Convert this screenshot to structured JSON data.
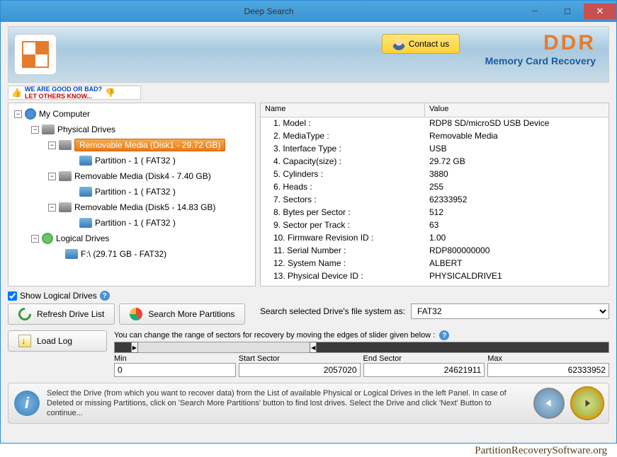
{
  "window": {
    "title": "Deep Search"
  },
  "banner": {
    "contact": "Contact us",
    "brand": "DDR",
    "brand_sub": "Memory Card Recovery"
  },
  "feedback": {
    "line1": "WE ARE GOOD OR BAD?",
    "line2": "LET OTHERS KNOW..."
  },
  "tree": {
    "root": "My Computer",
    "physical": "Physical Drives",
    "logical": "Logical Drives",
    "drives": [
      {
        "label": "Removable Media (Disk1 - 29.72 GB)",
        "partition": "Partition - 1 ( FAT32 )",
        "selected": true
      },
      {
        "label": "Removable Media (Disk4 - 7.40 GB)",
        "partition": "Partition - 1 ( FAT32 )",
        "selected": false
      },
      {
        "label": "Removable Media (Disk5 - 14.83 GB)",
        "partition": "Partition - 1 ( FAT32 )",
        "selected": false
      }
    ],
    "logical_drive": "F:\\ (29.71 GB  -  FAT32)"
  },
  "details": {
    "headers": {
      "name": "Name",
      "value": "Value"
    },
    "rows": [
      {
        "name": "1. Model :",
        "value": "RDP8 SD/microSD USB Device"
      },
      {
        "name": "2. MediaType :",
        "value": "Removable Media"
      },
      {
        "name": "3. Interface Type :",
        "value": "USB"
      },
      {
        "name": "4. Capacity(size) :",
        "value": "29.72 GB"
      },
      {
        "name": "5. Cylinders :",
        "value": "3880"
      },
      {
        "name": "6. Heads :",
        "value": "255"
      },
      {
        "name": "7. Sectors :",
        "value": "62333952"
      },
      {
        "name": "8. Bytes per Sector :",
        "value": "512"
      },
      {
        "name": "9. Sector per Track :",
        "value": "63"
      },
      {
        "name": "10. Firmware Revision ID :",
        "value": "1.00"
      },
      {
        "name": "11. Serial Number :",
        "value": "RDP800000000"
      },
      {
        "name": "12. System Name :",
        "value": "ALBERT"
      },
      {
        "name": "13. Physical Device ID :",
        "value": "PHYSICALDRIVE1"
      }
    ]
  },
  "controls": {
    "show_logical": "Show Logical Drives",
    "refresh": "Refresh Drive List",
    "search_more": "Search More Partitions",
    "load_log": "Load Log",
    "fs_label": "Search selected Drive's file system as:",
    "fs_selected": "FAT32"
  },
  "slider": {
    "hint": "You can change the range of sectors for recovery by moving the edges of slider given below :",
    "min_lbl": "Min",
    "min": "0",
    "start_lbl": "Start Sector",
    "start": "2057020",
    "end_lbl": "End Sector",
    "end": "24621911",
    "max_lbl": "Max",
    "max": "62333952"
  },
  "footer": {
    "text": "Select the Drive (from which you want to recover data) from the List of available Physical or Logical Drives in the left Panel. In case of Deleted or missing Partitions, click on 'Search More Partitions' button to find lost drives. Select the Drive and click 'Next' Button to continue..."
  },
  "watermark": "PartitionRecoverySoftware.org"
}
